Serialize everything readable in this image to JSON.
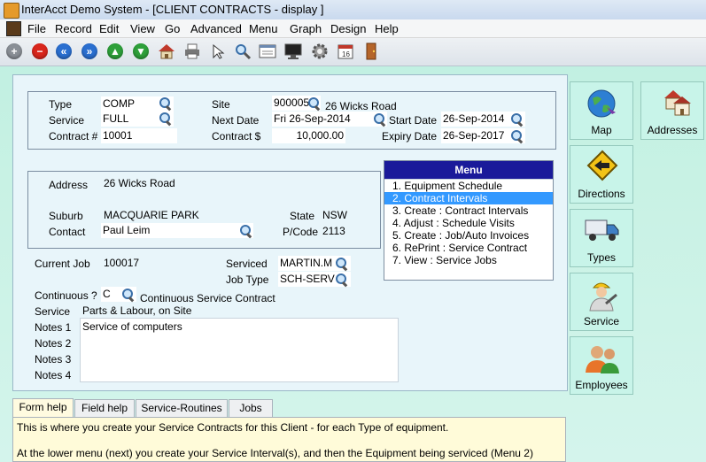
{
  "window": {
    "title": "InterAcct Demo System - [CLIENT CONTRACTS - display ]"
  },
  "menu": [
    "File",
    "Record",
    "Edit",
    "View",
    "Go",
    "Advanced",
    "Menu",
    "Graph",
    "Design",
    "Help"
  ],
  "toolbar": {
    "icons": [
      "refresh-icon",
      "stop-icon",
      "first-record-icon",
      "last-record-icon",
      "up-icon",
      "down-icon",
      "home-icon",
      "print-icon",
      "pointer-icon",
      "search-icon",
      "form-icon",
      "monitor-icon",
      "settings-icon",
      "calendar-icon",
      "door-exit-icon"
    ],
    "colors": {
      "grey": "#8a8f96",
      "red": "#d9261c",
      "blue": "#2a6fd0",
      "green": "#2ea03a"
    }
  },
  "contract": {
    "type_label": "Type",
    "type_value": "COMP",
    "service_label": "Service",
    "service_value": "FULL",
    "contract_no_label": "Contract #",
    "contract_no_value": "10001",
    "site_label": "Site",
    "site_value": "900005",
    "site_name": "26 Wicks Road",
    "next_date_label": "Next Date",
    "next_date_value": "Fri 26-Sep-2014",
    "start_date_label": "Start Date",
    "start_date_value": "26-Sep-2014",
    "contract_amount_label": "Contract $",
    "contract_amount_value": "10,000.00",
    "expiry_date_label": "Expiry Date",
    "expiry_date_value": "26-Sep-2017"
  },
  "address": {
    "address_label": "Address",
    "address_value": "26 Wicks Road",
    "suburb_label": "Suburb",
    "suburb_value": "MACQUARIE PARK",
    "state_label": "State",
    "state_value": "NSW",
    "contact_label": "Contact",
    "contact_value": "Paul Leim",
    "postcode_label": "P/Code",
    "postcode_value": "2113"
  },
  "job": {
    "current_job_label": "Current Job",
    "current_job_value": "100017",
    "serviced_label": "Serviced",
    "serviced_value": "MARTIN.M",
    "job_type_label": "Job Type",
    "job_type_value": "SCH-SERV",
    "continuous_label": "Continuous ?",
    "continuous_value": "C",
    "continuous_desc": "Continuous Service Contract",
    "service_label": "Service",
    "service_value": "Parts & Labour, on Site",
    "notes1_label": "Notes 1",
    "notes2_label": "Notes 2",
    "notes3_label": "Notes 3",
    "notes4_label": "Notes 4",
    "notes_value": "Service of computers"
  },
  "menubox": {
    "title": "Menu",
    "items": [
      "1. Equipment Schedule",
      "2. Contract Intervals",
      "3. Create : Contract Intervals",
      "4. Adjust : Schedule Visits",
      "5. Create : Job/Auto Invoices",
      "6. RePrint : Service Contract",
      "7. View : Service Jobs"
    ],
    "selected_index": 1,
    "colors": {
      "header": "#1a1a9a",
      "selected": "#3399ff"
    }
  },
  "sidebar": {
    "buttons": [
      "Map",
      "Addresses",
      "Directions",
      "Types",
      "Service",
      "Employees"
    ]
  },
  "help": {
    "tabs": [
      "Form help",
      "Field help",
      "Service-Routines",
      "Jobs"
    ],
    "active_tab": 0,
    "line1": "This is where you create your Service Contracts for this Client - for each Type of equipment.",
    "line2": "At the lower menu (next) you create your Service Interval(s), and then the Equipment being serviced (Menu 2)"
  }
}
